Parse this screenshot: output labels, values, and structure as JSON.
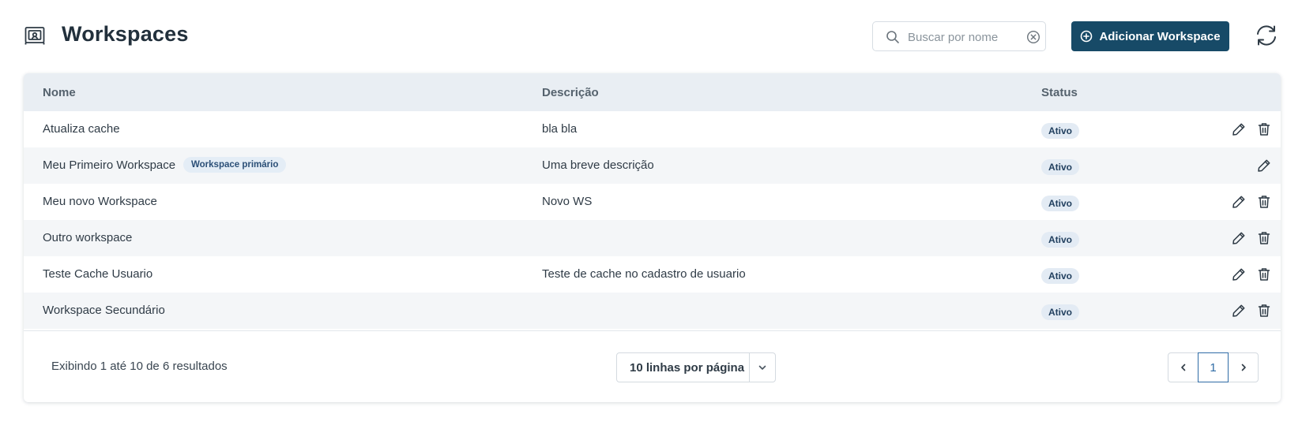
{
  "header": {
    "title": "Workspaces",
    "icon": "workspace-icon",
    "search_placeholder": "Buscar por nome",
    "search_value": "",
    "add_label": "Adicionar Workspace",
    "accent_color": "#174a67"
  },
  "table": {
    "columns": [
      "Nome",
      "Descrição",
      "Status"
    ],
    "rows": [
      {
        "name": "Atualiza cache",
        "badge": "",
        "description": "bla bla",
        "status": "Ativo",
        "actions": [
          "edit",
          "delete"
        ]
      },
      {
        "name": "Meu Primeiro Workspace",
        "badge": "Workspace primário",
        "description": "Uma breve descrição",
        "status": "Ativo",
        "actions": [
          "edit"
        ]
      },
      {
        "name": "Meu novo Workspace",
        "badge": "",
        "description": "Novo WS",
        "status": "Ativo",
        "actions": [
          "edit",
          "delete"
        ]
      },
      {
        "name": "Outro workspace",
        "badge": "",
        "description": "",
        "status": "Ativo",
        "actions": [
          "edit",
          "delete"
        ]
      },
      {
        "name": "Teste Cache Usuario",
        "badge": "",
        "description": "Teste de cache no cadastro de usuario",
        "status": "Ativo",
        "actions": [
          "edit",
          "delete"
        ]
      },
      {
        "name": "Workspace Secundário",
        "badge": "",
        "description": "",
        "status": "Ativo",
        "actions": [
          "edit",
          "delete"
        ]
      }
    ]
  },
  "footer": {
    "summary": "Exibindo 1 até 10 de 6 resultados",
    "rows_per_page": "10 linhas por página",
    "current_page": "1"
  }
}
